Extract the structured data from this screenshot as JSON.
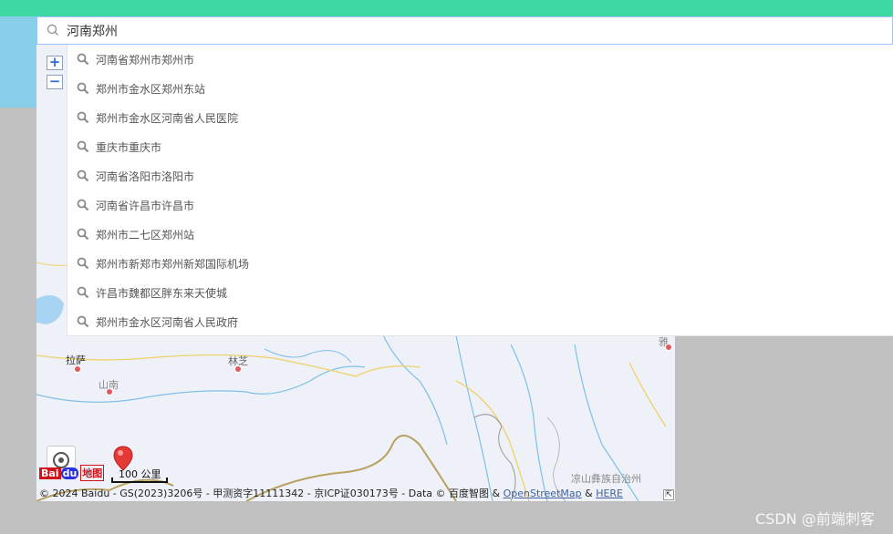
{
  "search": {
    "value": "河南郑州",
    "icon": "search-icon"
  },
  "suggestions": [
    "河南省郑州市郑州市",
    "郑州市金水区郑州东站",
    "郑州市金水区河南省人民医院",
    "重庆市重庆市",
    "河南省洛阳市洛阳市",
    "河南省许昌市许昌市",
    "郑州市二七区郑州站",
    "郑州市新郑市郑州新郑国际机场",
    "许昌市魏都区胖东来天使城",
    "郑州市金水区河南省人民政府"
  ],
  "map": {
    "zoom_in": "+",
    "zoom_out": "−",
    "labels": {
      "lasa": "拉萨",
      "linzhi": "林芝",
      "shannan": "山南",
      "liangshan": "凉山彝族自治州",
      "ya": "雅"
    },
    "scale": "100 公里",
    "logo": {
      "bai": "Bai",
      "du": "du",
      "ditu": "地图"
    },
    "copyright_text": "© 2024 Baidu - GS(2023)3206号 - 甲测资字11111342 - 京ICP证030173号 - Data © 百度智图 & ",
    "osm_link": "OpenStreetMap",
    "amp": " & ",
    "here_link": "HERE",
    "expand": "⇱"
  },
  "watermark": "CSDN @前端刺客",
  "colors": {
    "topbar": "#3dd9a4",
    "search_border": "#9cc3ff",
    "map_bg": "#eef2f8",
    "river": "#7fbfe8",
    "road": "#f0d06a",
    "border": "#b8a060"
  }
}
